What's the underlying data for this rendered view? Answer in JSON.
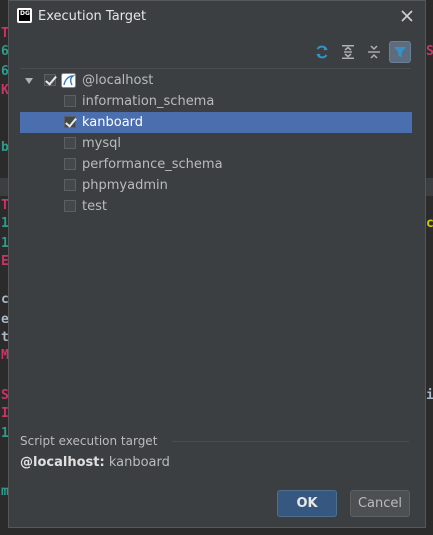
{
  "window": {
    "title": "Execution Target",
    "app_icon": "datagrip-icon"
  },
  "toolbar": {
    "buttons": [
      {
        "name": "refresh-icon"
      },
      {
        "name": "expand-all-icon"
      },
      {
        "name": "collapse-all-icon"
      },
      {
        "name": "filter-icon",
        "active": true
      }
    ]
  },
  "tree": {
    "root": {
      "label": "@localhost",
      "checked": true,
      "expanded": true
    },
    "items": [
      {
        "label": "information_schema",
        "checked": false
      },
      {
        "label": "kanboard",
        "checked": true,
        "selected": true
      },
      {
        "label": "mysql",
        "checked": false
      },
      {
        "label": "performance_schema",
        "checked": false
      },
      {
        "label": "phpmyadmin",
        "checked": false
      },
      {
        "label": "test",
        "checked": false
      }
    ]
  },
  "footer": {
    "section_label": "Script execution target",
    "target_host": "@localhost:",
    "target_db": "kanboard"
  },
  "buttons": {
    "ok": "OK",
    "cancel": "Cancel"
  },
  "colors": {
    "selection": "#4b6eaf",
    "dialog_bg": "#3c3f41",
    "accent_blue": "#3592c4"
  }
}
